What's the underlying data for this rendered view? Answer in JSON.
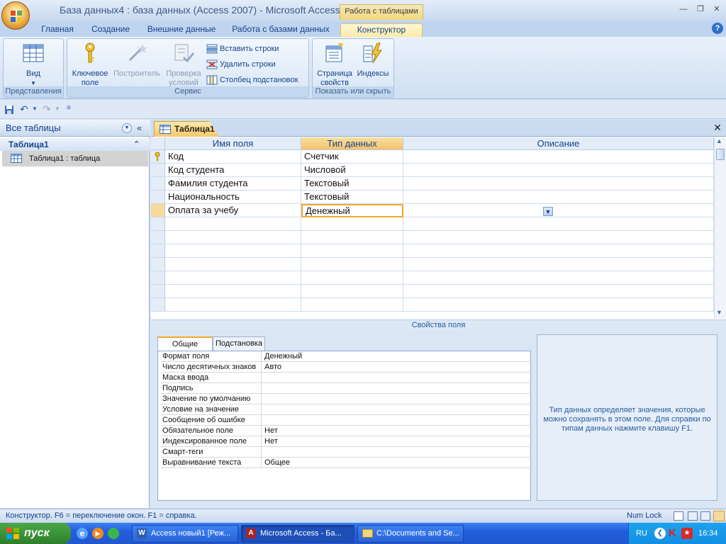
{
  "window": {
    "title_db": "База данных4 : база данных (Access 2007)",
    "title_sep": "-",
    "title_app": "Microsoft Access",
    "context_tab_header": "Работа с таблицами"
  },
  "ribbon": {
    "tabs": [
      "Главная",
      "Создание",
      "Внешние данные",
      "Работа с базами данных",
      "Конструктор"
    ],
    "active_tab": "Конструктор",
    "groups": {
      "views": {
        "label": "Представления",
        "view_button": "Вид"
      },
      "tools": {
        "label": "Сервис",
        "primary_key": "Ключевое поле",
        "builder": "Построитель",
        "test_rules": "Проверка условий",
        "insert_rows": "Вставить строки",
        "delete_rows": "Удалить строки",
        "lookup_column": "Столбец  подстановок"
      },
      "show_hide": {
        "label": "Показать или скрыть",
        "property_sheet": "Страница свойств",
        "indexes": "Индексы"
      }
    }
  },
  "nav_pane": {
    "header": "Все таблицы",
    "group": "Таблица1",
    "items": [
      "Таблица1 : таблица"
    ]
  },
  "document": {
    "tab_label": "Таблица1",
    "columns": [
      "Имя поля",
      "Тип данных",
      "Описание"
    ],
    "rows": [
      {
        "name": "Код",
        "type": "Счетчик",
        "desc": ""
      },
      {
        "name": "Код студента",
        "type": "Числовой",
        "desc": ""
      },
      {
        "name": "Фамилия студента",
        "type": "Текстовый",
        "desc": ""
      },
      {
        "name": "Национальность",
        "type": "Текстовый",
        "desc": ""
      },
      {
        "name": "Оплата за учебу",
        "type": "Денежный",
        "desc": ""
      }
    ]
  },
  "field_properties": {
    "title": "Свойства поля",
    "tabs": [
      "Общие",
      "Подстановка"
    ],
    "active_tab": "Общие",
    "rows": [
      {
        "name": "Формат поля",
        "value": "Денежный"
      },
      {
        "name": "Число десятичных знаков",
        "value": "Авто"
      },
      {
        "name": "Маска ввода",
        "value": ""
      },
      {
        "name": "Подпись",
        "value": ""
      },
      {
        "name": "Значение по умолчанию",
        "value": ""
      },
      {
        "name": "Условие на значение",
        "value": ""
      },
      {
        "name": "Сообщение об ошибке",
        "value": ""
      },
      {
        "name": "Обязательное поле",
        "value": "Нет"
      },
      {
        "name": "Индексированное поле",
        "value": "Нет"
      },
      {
        "name": "Смарт-теги",
        "value": ""
      },
      {
        "name": "Выравнивание текста",
        "value": "Общее"
      }
    ],
    "help_text": "Тип данных определяет значения, которые можно сохранять в этом поле.  Для справки по типам данных нажмите клавишу F1."
  },
  "status_bar": {
    "text": "Конструктор.  F6 = переключение окон.  F1 = справка.",
    "num_lock": "Num Lock"
  },
  "taskbar": {
    "start": "пуск",
    "items": [
      "Access новый1 [Реж...",
      "Microsoft Access - Ба...",
      "C:\\Documents and Se..."
    ],
    "language": "RU",
    "clock": "16:34"
  },
  "colors": {
    "accent": "#f0a830",
    "ribbon_blue": "#15428b",
    "taskbar_blue": "#245edb",
    "start_green": "#3a9438"
  }
}
